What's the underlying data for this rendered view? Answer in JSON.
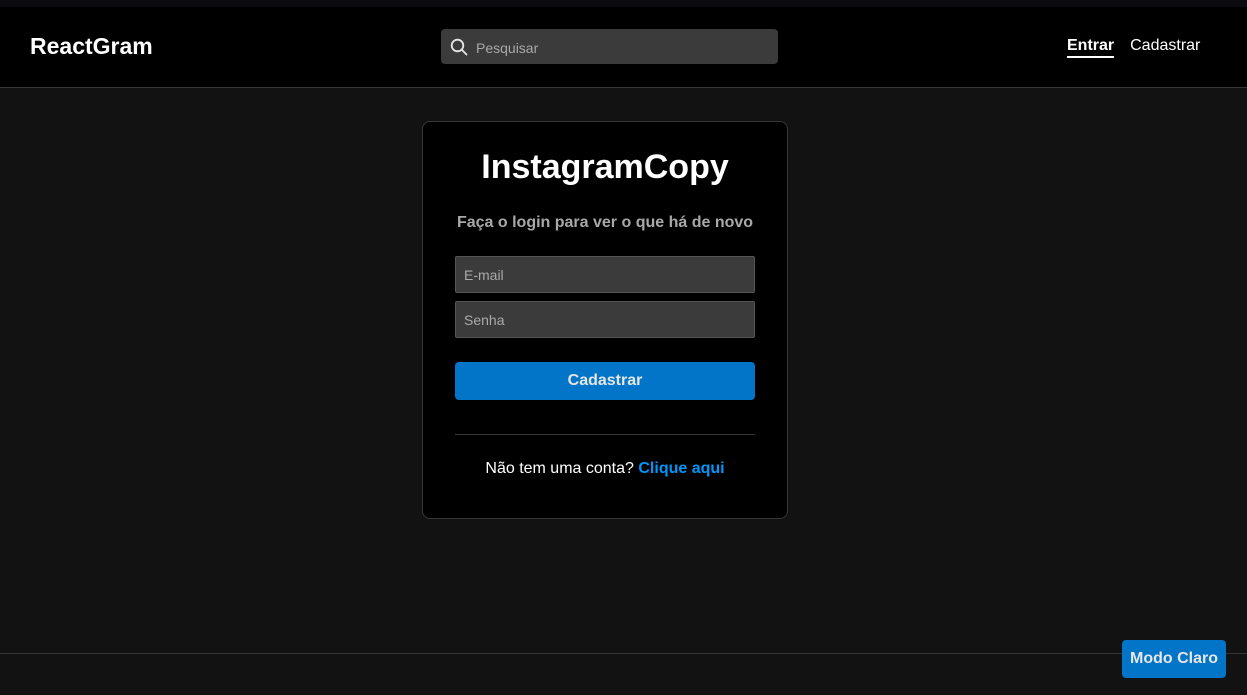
{
  "navbar": {
    "brand": "ReactGram",
    "search": {
      "placeholder": "Pesquisar",
      "icon": "search-icon"
    },
    "links": [
      {
        "label": "Entrar",
        "active": true
      },
      {
        "label": "Cadastrar",
        "active": false
      }
    ]
  },
  "login": {
    "title": "InstagramCopy",
    "subtitle": "Faça o login para ver o que há de novo",
    "email_placeholder": "E-mail",
    "password_placeholder": "Senha",
    "submit_label": "Cadastrar",
    "signup_prompt": "Não tem uma conta?",
    "signup_link": "Clique aqui"
  },
  "theme_toggle": {
    "label": "Modo Claro"
  },
  "colors": {
    "accent": "#0275c8",
    "link": "#0095f6",
    "background": "#121212",
    "panel": "#000000"
  }
}
